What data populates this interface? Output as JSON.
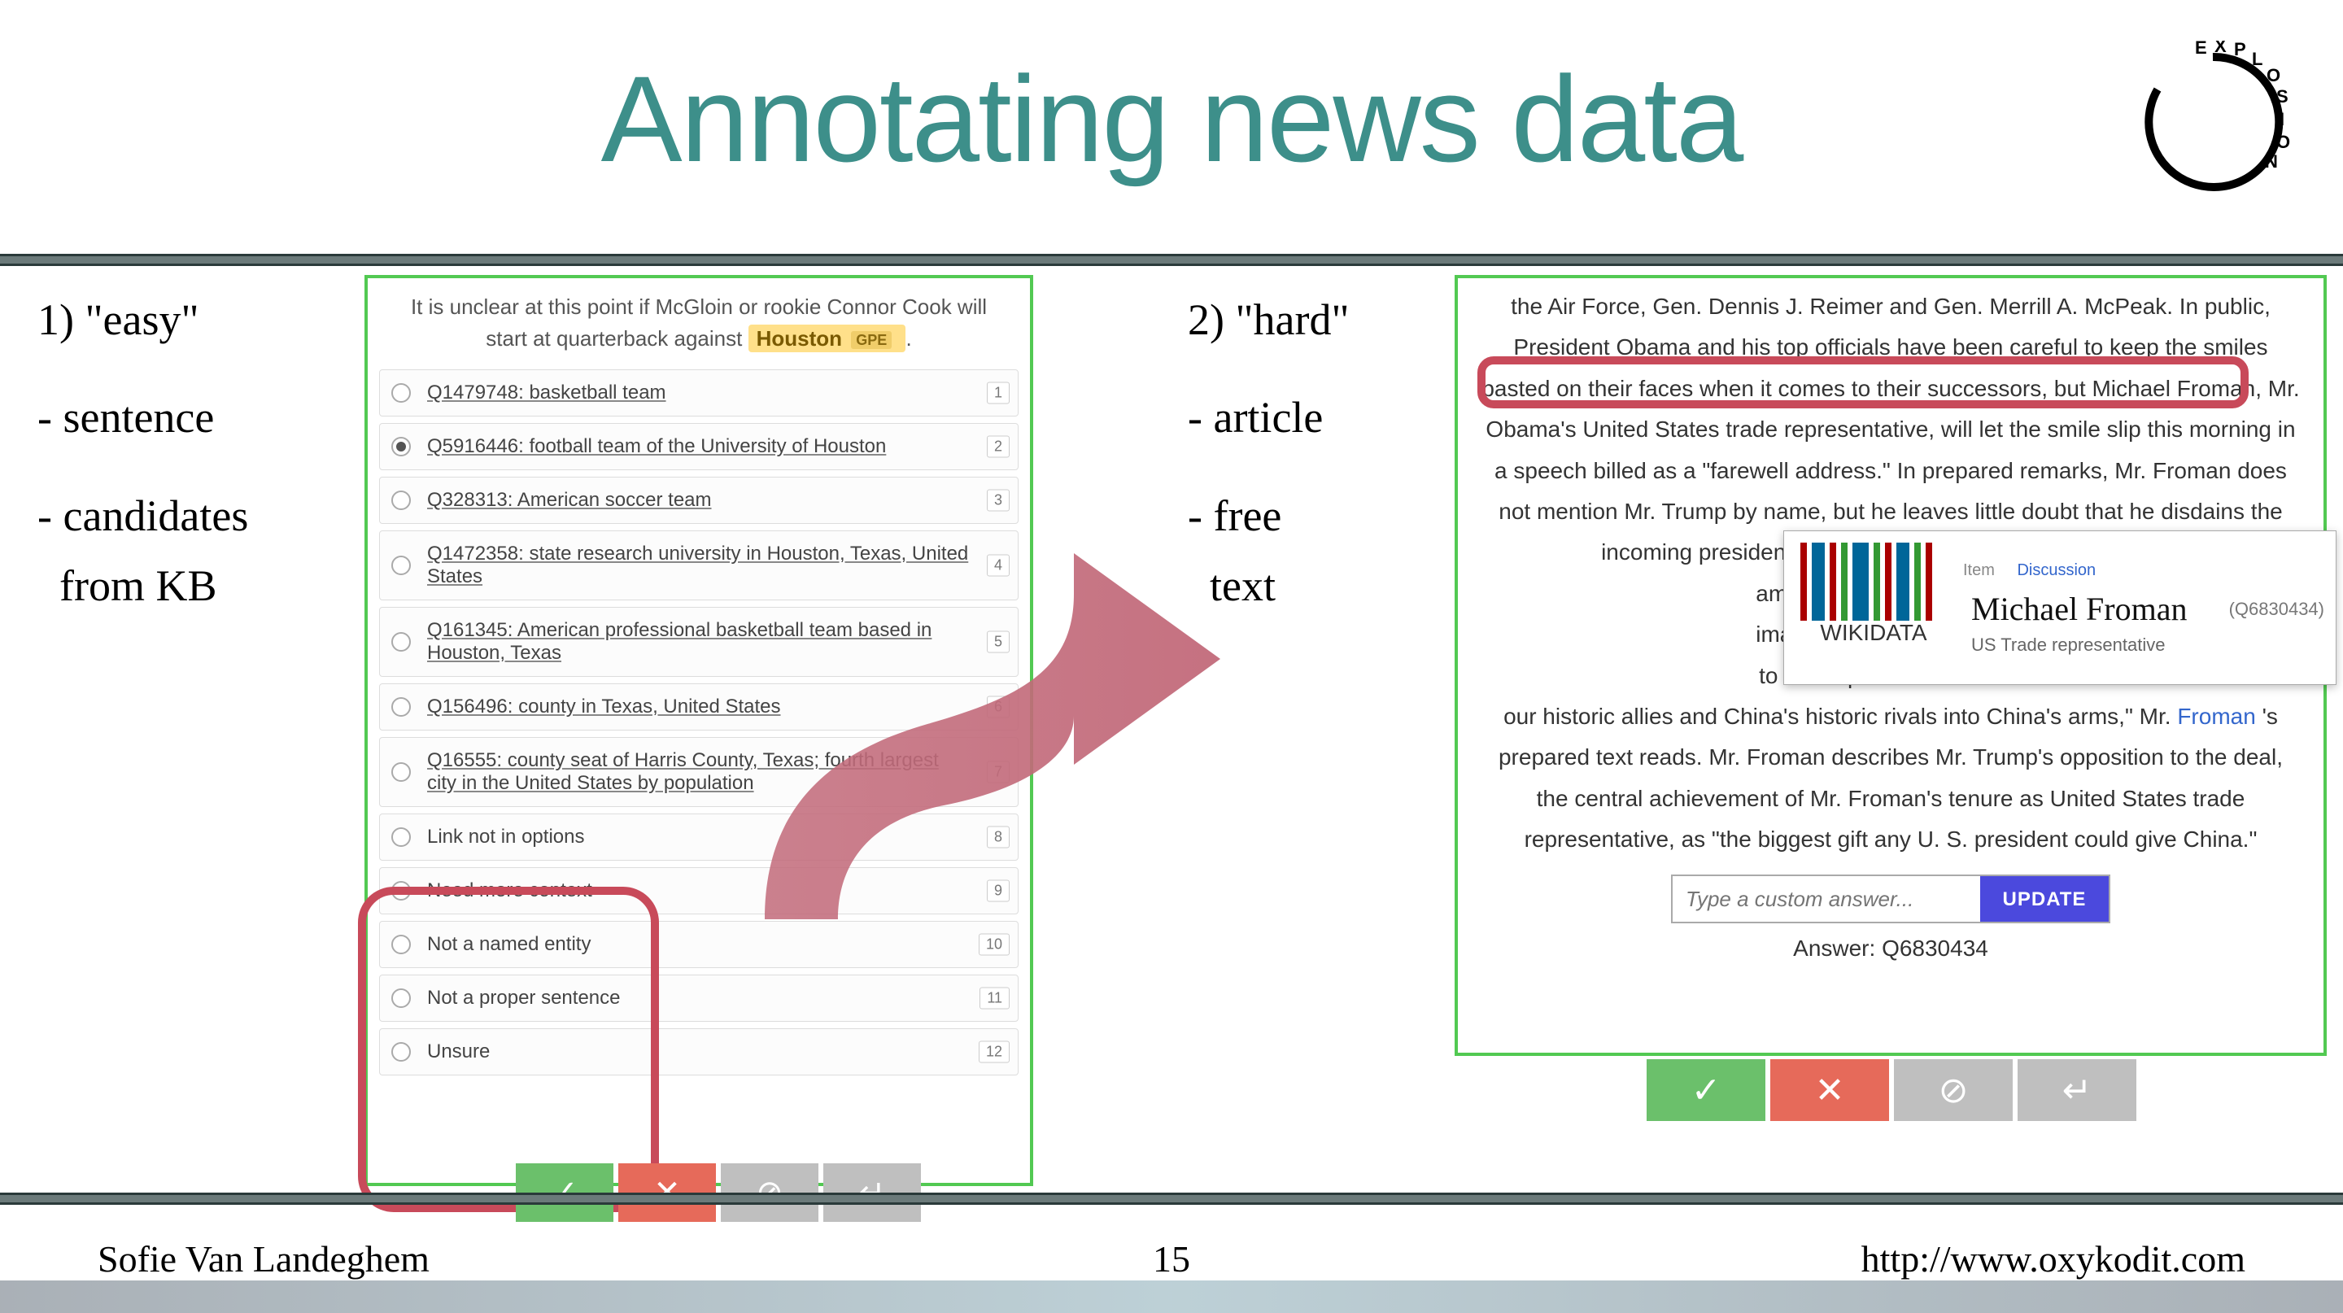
{
  "title": "Annotating news data",
  "logo_text": "EXPLOSION",
  "left_notes": {
    "heading": "1) \"easy\"",
    "b1": "- sentence",
    "b2": "- candidates",
    "b2b": "  from KB"
  },
  "center_notes": {
    "heading": "2) \"hard\"",
    "b1": "- article",
    "b2": "- free",
    "b2b": "  text"
  },
  "easy_panel": {
    "sentence_prefix": "It is unclear at this point if McGloin or rookie Connor Cook will start at quarterback against ",
    "highlight": "Houston",
    "highlight_tag": "GPE",
    "sentence_suffix": " .",
    "options": [
      {
        "label": "Q1479748: basketball team",
        "num": "1",
        "selected": false,
        "ul": true
      },
      {
        "label": "Q5916446: football team of the University of Houston",
        "num": "2",
        "selected": true,
        "ul": true
      },
      {
        "label": "Q328313: American soccer team",
        "num": "3",
        "selected": false,
        "ul": true
      },
      {
        "label": "Q1472358: state research university in Houston, Texas, United States",
        "num": "4",
        "selected": false,
        "ul": true
      },
      {
        "label": "Q161345: American professional basketball team based in Houston, Texas",
        "num": "5",
        "selected": false,
        "ul": true
      },
      {
        "label": "Q156496: county in Texas, United States",
        "num": "6",
        "selected": false,
        "ul": true
      },
      {
        "label": "Q16555: county seat of Harris County, Texas; fourth largest city in the United States by population",
        "num": "7",
        "selected": false,
        "ul": true
      },
      {
        "label": "Link not in options",
        "num": "8",
        "selected": false,
        "ul": false
      },
      {
        "label": "Need more context",
        "num": "9",
        "selected": false,
        "ul": false
      },
      {
        "label": "Not a named entity",
        "num": "10",
        "selected": false,
        "ul": false
      },
      {
        "label": "Not a proper sentence",
        "num": "11",
        "selected": false,
        "ul": false
      },
      {
        "label": "Unsure",
        "num": "12",
        "selected": false,
        "ul": false
      }
    ]
  },
  "hard_panel": {
    "article_pre": "the Air Force, Gen. Dennis J. Reimer and Gen. Merrill A. McPeak. In public, President Obama and his top officials have been careful to keep the smiles pasted on their faces when it comes to their successors, but ",
    "article_hl": "Michael Froman, Mr. Obama's United States trade representative,",
    "article_mid": " will let the smile slip this morning in a speech billed as a \"farewell address.\" In prepared remarks, Mr. Froman does not mention Mr. Trump by name, but he leaves little doubt that he disdains the incoming president's views on trade, particularly Mr. Trum",
    "article_mid2": " among Pacific Rim nations",
    "article_mid3": " imagine why any president",
    "article_mid4": " to be responsible for hand",
    "article_post1": "our historic allies and China's historic rivals into China's arms,\" Mr. ",
    "article_link": "Froman",
    "article_post2": "'s prepared text reads. Mr. Froman describes Mr. Trump's opposition to the deal, the central achievement of Mr. Froman's tenure as United States trade representative, as \"the biggest gift any U. S. president could give China.\"",
    "popup": {
      "item_label": "Item",
      "tab": "Discussion",
      "title": "Michael Froman",
      "qid": "(Q6830434)",
      "desc": "US Trade representative",
      "logo_text": "WIKIDATA"
    },
    "input_placeholder": "Type a custom answer...",
    "update_label": "UPDATE",
    "answer_label": "Answer: Q6830434"
  },
  "actions": {
    "accept": "✓",
    "reject": "✕",
    "skip": "⊘",
    "undo": "↵"
  },
  "footer": {
    "author": "Sofie Van Landeghem",
    "page": "15",
    "url": "http://www.oxykodit.com"
  }
}
